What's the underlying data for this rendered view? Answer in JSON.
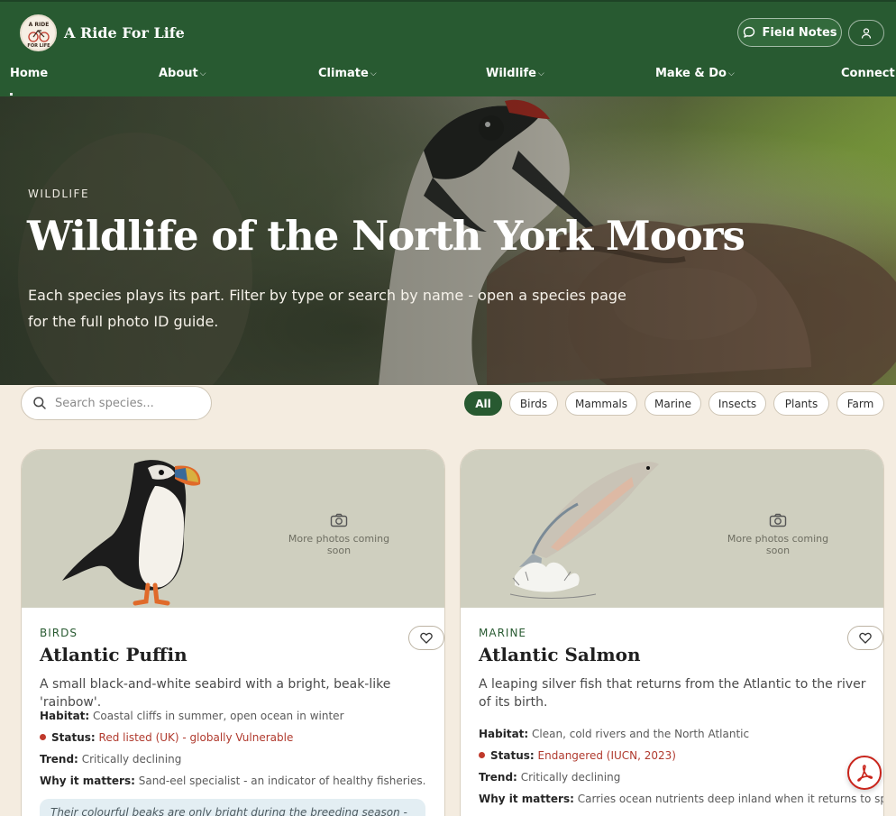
{
  "header": {
    "brand": "A Ride For Life",
    "logo_text": [
      "A RIDE",
      "FOR LIFE"
    ],
    "field_notes": "Field Notes",
    "nav": [
      "Home",
      "About",
      "Climate",
      "Wildlife",
      "Make & Do",
      "Connect"
    ],
    "nav_caret": "⌵"
  },
  "hero": {
    "kicker": "WILDLIFE",
    "title": "Wildlife of the North York Moors",
    "subtitle": "Each species plays its part. Filter by type or search by name - open a species page for the full photo ID guide."
  },
  "filters": {
    "search_placeholder": "Search species...",
    "chips": [
      "All",
      "Birds",
      "Mammals",
      "Marine",
      "Insects",
      "Plants",
      "Farm"
    ],
    "active": "All"
  },
  "cards": [
    {
      "category": "BIRDS",
      "name": "Atlantic Puffin",
      "description": "A small black-and-white seabird with a bright, beak-like 'rainbow'.",
      "photos_note": "More photos coming soon",
      "habitat_label": "Habitat:",
      "habitat": "Coastal cliffs in summer, open ocean in winter",
      "status_label": "Status:",
      "status": "Red listed (UK) - globally Vulnerable",
      "trend_label": "Trend:",
      "trend": "Critically declining",
      "why_label": "Why it matters:",
      "why": "Sand-eel specialist - an indicator of healthy fisheries.",
      "note": "Their colourful beaks are only bright during the breeding season - they"
    },
    {
      "category": "MARINE",
      "name": "Atlantic Salmon",
      "description": "A leaping silver fish that returns from the Atlantic to the river of its birth.",
      "photos_note": "More photos coming soon",
      "habitat_label": "Habitat:",
      "habitat": "Clean, cold rivers and the North Atlantic",
      "status_label": "Status:",
      "status": "Endangered (IUCN, 2023)",
      "trend_label": "Trend:",
      "trend": "Critically declining",
      "why_label": "Why it matters:",
      "why": "Carries ocean nutrients deep inland when it returns to spawn."
    }
  ],
  "colors": {
    "header_green": "#285a31",
    "page_bg": "#f4ece0",
    "status_red": "#b03a2e",
    "card_media": "#cfcfbf"
  },
  "icons": [
    "logo-icon",
    "chat-bubble-icon",
    "user-icon",
    "search-icon",
    "camera-icon",
    "heart-icon",
    "pdf-icon"
  ]
}
